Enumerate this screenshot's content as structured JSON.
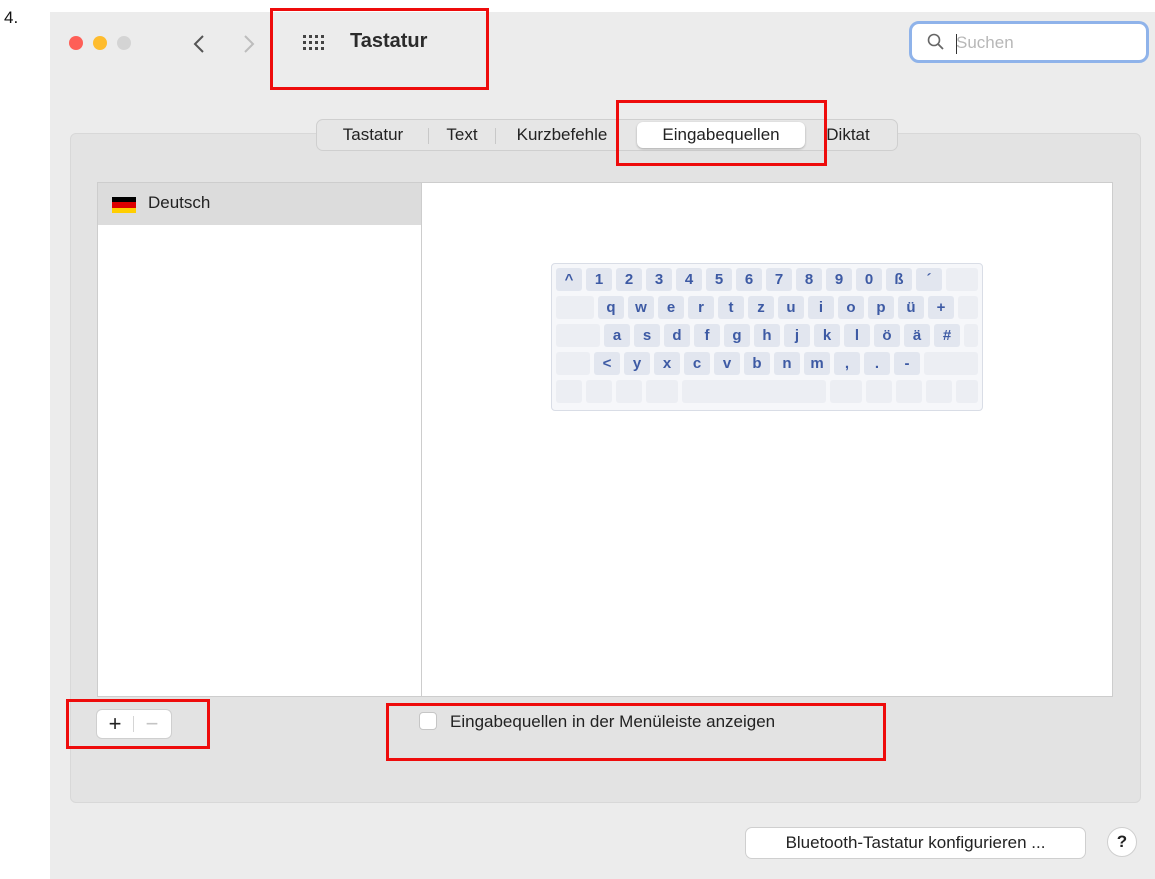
{
  "step_label": "4.",
  "window": {
    "title": "Tastatur",
    "search_placeholder": "Suchen"
  },
  "tabs": [
    {
      "label": "Tastatur",
      "selected": false
    },
    {
      "label": "Text",
      "selected": false
    },
    {
      "label": "Kurzbefehle",
      "selected": false
    },
    {
      "label": "Eingabequellen",
      "selected": true
    },
    {
      "label": "Diktat",
      "selected": false
    }
  ],
  "input_sources": [
    {
      "label": "Deutsch",
      "flag": "de-flag-icon",
      "selected": true
    }
  ],
  "keyboard_preview": {
    "rows": [
      [
        "^",
        "1",
        "2",
        "3",
        "4",
        "5",
        "6",
        "7",
        "8",
        "9",
        "0",
        "ß",
        "´"
      ],
      [
        "q",
        "w",
        "e",
        "r",
        "t",
        "z",
        "u",
        "i",
        "o",
        "p",
        "ü",
        "+"
      ],
      [
        "a",
        "s",
        "d",
        "f",
        "g",
        "h",
        "j",
        "k",
        "l",
        "ö",
        "ä",
        "#"
      ],
      [
        "<",
        "y",
        "x",
        "c",
        "v",
        "b",
        "n",
        "m",
        ",",
        ".",
        "-"
      ]
    ]
  },
  "controls": {
    "add_label": "+",
    "remove_label": "−",
    "show_in_menubar_label": "Eingabequellen in der Menüleiste anzeigen",
    "show_in_menubar_checked": false,
    "bluetooth_button": "Bluetooth-Tastatur konfigurieren ...",
    "help_button": "?"
  },
  "colors": {
    "annotation": "#ee0c0c",
    "key_text": "#3d5aa4",
    "flag_black": "#000000",
    "flag_red": "#dd0000",
    "flag_gold": "#ffce00"
  }
}
